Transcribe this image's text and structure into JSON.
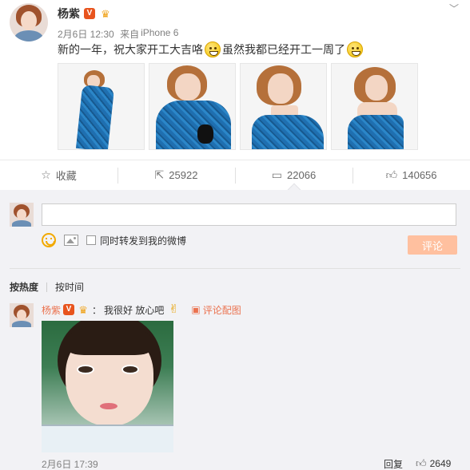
{
  "post": {
    "author": "杨紫",
    "verified_icon": "v-badge-icon",
    "member_icon": "crown-icon",
    "date": "2月6日 12:30",
    "source_prefix": "来自",
    "source": "iPhone 6",
    "text_part1": "新的一年，祝大家开工大吉咯",
    "text_part2": "虽然我都已经开工一周了",
    "photo_count": 4
  },
  "actions": {
    "favorite_label": "收藏",
    "repost_count": "25922",
    "comment_count": "22066",
    "like_count": "140656"
  },
  "composer": {
    "input_value": "",
    "repost_label": "同时转发到我的微博",
    "submit_label": "评论"
  },
  "sort": {
    "hot_label": "按热度",
    "time_label": "按时间"
  },
  "comment": {
    "author": "杨紫",
    "colon": "：",
    "text": "我很好 放心吧",
    "picture_ref": "评论配图",
    "time": "2月6日 17:39",
    "reply_label": "回复",
    "like_count": "2649"
  },
  "colors": {
    "accent": "#eb7350",
    "submit_disabled": "#ffc09f",
    "panel_bg": "#f2f2f5"
  }
}
